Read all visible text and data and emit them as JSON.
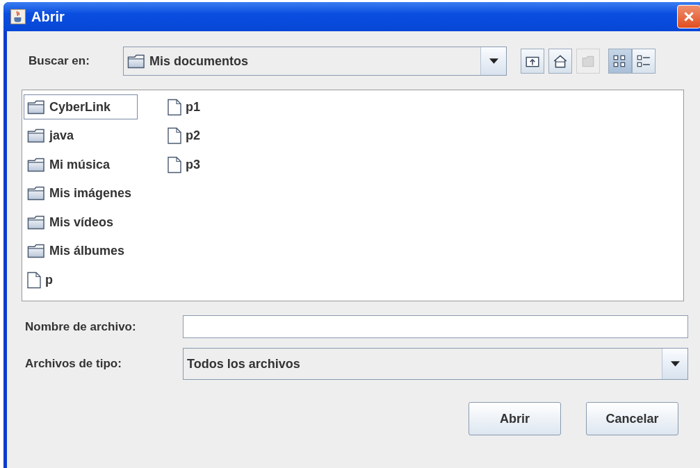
{
  "window": {
    "title": "Abrir"
  },
  "look_in": {
    "label": "Buscar en:",
    "value": "Mis documentos"
  },
  "toolbar_buttons": [
    {
      "kind": "up",
      "disabled": false,
      "selected": false
    },
    {
      "kind": "home",
      "disabled": false,
      "selected": false
    },
    {
      "kind": "new-folder",
      "disabled": true,
      "selected": false
    },
    {
      "kind": "list",
      "disabled": false,
      "selected": true
    },
    {
      "kind": "details",
      "disabled": false,
      "selected": false
    }
  ],
  "files": [
    {
      "kind": "folder",
      "name": "CyberLink",
      "selected": true
    },
    {
      "kind": "folder",
      "name": "java",
      "selected": false
    },
    {
      "kind": "folder",
      "name": "Mi música",
      "selected": false
    },
    {
      "kind": "folder",
      "name": "Mis imágenes",
      "selected": false
    },
    {
      "kind": "folder",
      "name": "Mis vídeos",
      "selected": false
    },
    {
      "kind": "folder",
      "name": "Mis álbumes",
      "selected": false
    },
    {
      "kind": "file",
      "name": "p",
      "selected": false
    },
    {
      "kind": "file",
      "name": "p1",
      "selected": false
    },
    {
      "kind": "file",
      "name": "p2",
      "selected": false
    },
    {
      "kind": "file",
      "name": "p3",
      "selected": false
    }
  ],
  "file_name": {
    "label": "Nombre de archivo:"
  },
  "file_type": {
    "label": "Archivos de tipo:",
    "value": "Todos los archivos"
  },
  "buttons": [
    "Abrir",
    "Cancelar"
  ]
}
